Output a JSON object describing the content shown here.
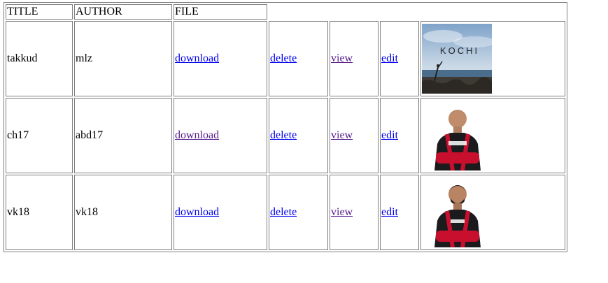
{
  "table": {
    "headers": {
      "title": "TITLE",
      "author": "AUTHOR",
      "file": "FILE"
    },
    "rows": [
      {
        "title": "takkud",
        "author": "mlz",
        "download": "download",
        "delete": "delete",
        "view": "view",
        "edit": "edit",
        "image": {
          "kind": "photo-kochi-poster",
          "caption": "KOCHI"
        }
      },
      {
        "title": "ch17",
        "author": "abd17",
        "download": "download",
        "delete": "delete",
        "view": "view",
        "edit": "edit",
        "image": {
          "kind": "photo-cricketer-red-black-jersey"
        }
      },
      {
        "title": "vk18",
        "author": "vk18",
        "download": "download",
        "delete": "delete",
        "view": "view",
        "edit": "edit",
        "image": {
          "kind": "photo-cricketer-red-black-jersey"
        }
      }
    ]
  },
  "colors": {
    "link": "#0000ee",
    "visited_link": "#551a8b",
    "border": "#808080"
  }
}
